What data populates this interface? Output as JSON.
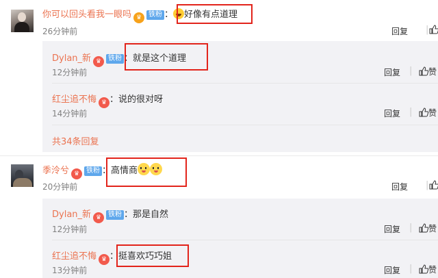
{
  "comments": [
    {
      "user": "你可以回头看我一眼吗",
      "badge": "铁粉",
      "text": "好像有点道理",
      "time": "26分钟前",
      "reply_label": "回复",
      "replies": [
        {
          "user": "Dylan_新",
          "badge": "铁粉",
          "text": "就是这个道理",
          "time": "12分钟前",
          "reply_label": "回复",
          "like_label": "赞"
        },
        {
          "user": "红尘追不悔",
          "badge": "",
          "text": "说的很对呀",
          "time": "14分钟前",
          "reply_label": "回复",
          "like_label": "赞"
        }
      ],
      "more_replies": "共34条回复"
    },
    {
      "user": "季泠兮",
      "badge": "铁粉",
      "text": "高情商",
      "time": "20分钟前",
      "reply_label": "回复",
      "replies": [
        {
          "user": "Dylan_新",
          "badge": "铁粉",
          "text": "那是自然",
          "time": "12分钟前",
          "reply_label": "回复",
          "like_label": "赞"
        },
        {
          "user": "红尘追不悔",
          "badge": "",
          "text": "挺喜欢巧巧姐",
          "time": "13分钟前",
          "reply_label": "回复",
          "like_label": "赞"
        }
      ]
    }
  ],
  "colors": {
    "username": "#eb7350",
    "highlight_border": "#e2231a",
    "reply_background": "#f2f2f5",
    "fan_badge": "#5ea7ec"
  },
  "icons": {
    "vip": "crown-vip-icon",
    "like": "thumbs-up-icon",
    "emoji_1": "laughing-emoji",
    "emoji_2": "cat-face-emoji"
  }
}
